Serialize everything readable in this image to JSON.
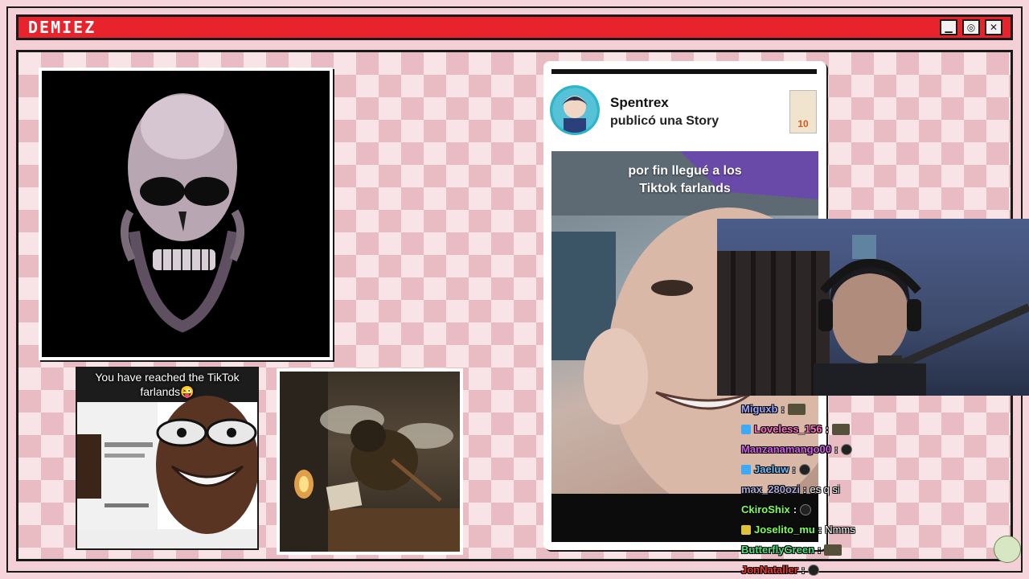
{
  "window": {
    "title": "DEMIEZ",
    "controls": {
      "minimize": "▁",
      "maximize": "◎",
      "close": "✕"
    }
  },
  "meme_left": {
    "caption": "You have reached the TikTok farlands😜"
  },
  "story": {
    "username": "Spentrex",
    "action": "publicó una Story",
    "thumb_number": "10",
    "caption_line1": "por fin llegué a los",
    "caption_line2": "Tiktok farlands"
  },
  "chat": [
    {
      "user": "Miguxb",
      "color": "#9aa6ff",
      "badge": "",
      "text": "",
      "emote": "wide"
    },
    {
      "user": "Loveless_156",
      "color": "#ff6ec7",
      "badge": "#3da9f7",
      "text": "",
      "emote": "wide"
    },
    {
      "user": "Manzanamango00",
      "color": "#d35de8",
      "badge": "",
      "text": "",
      "emote": "small"
    },
    {
      "user": "Jaeluw",
      "color": "#6ec0ff",
      "badge": "#3da9f7",
      "text": "",
      "emote": "small"
    },
    {
      "user": "max_280ozi",
      "color": "#a6a6d8",
      "badge": "",
      "text": "es q si",
      "emote": ""
    },
    {
      "user": "CkiroShix",
      "color": "#7dff5a",
      "badge": "",
      "text": "",
      "emote": "small"
    },
    {
      "user": "Joselito_mu",
      "color": "#7dff5a",
      "badge": "#e0c23a",
      "text": "Nmms",
      "emote": ""
    },
    {
      "user": "ButterflyGreen",
      "color": "#49e37b",
      "badge": "",
      "text": "",
      "emote": "wide"
    },
    {
      "user": "JonNataller",
      "color": "#e8362f",
      "badge": "",
      "text": "",
      "emote": "small"
    }
  ],
  "colors": {
    "titlebar": "#e8232b",
    "board_light": "#f8e3e7",
    "board_dark": "#e9bcc4",
    "frame": "#1a1a1a"
  }
}
